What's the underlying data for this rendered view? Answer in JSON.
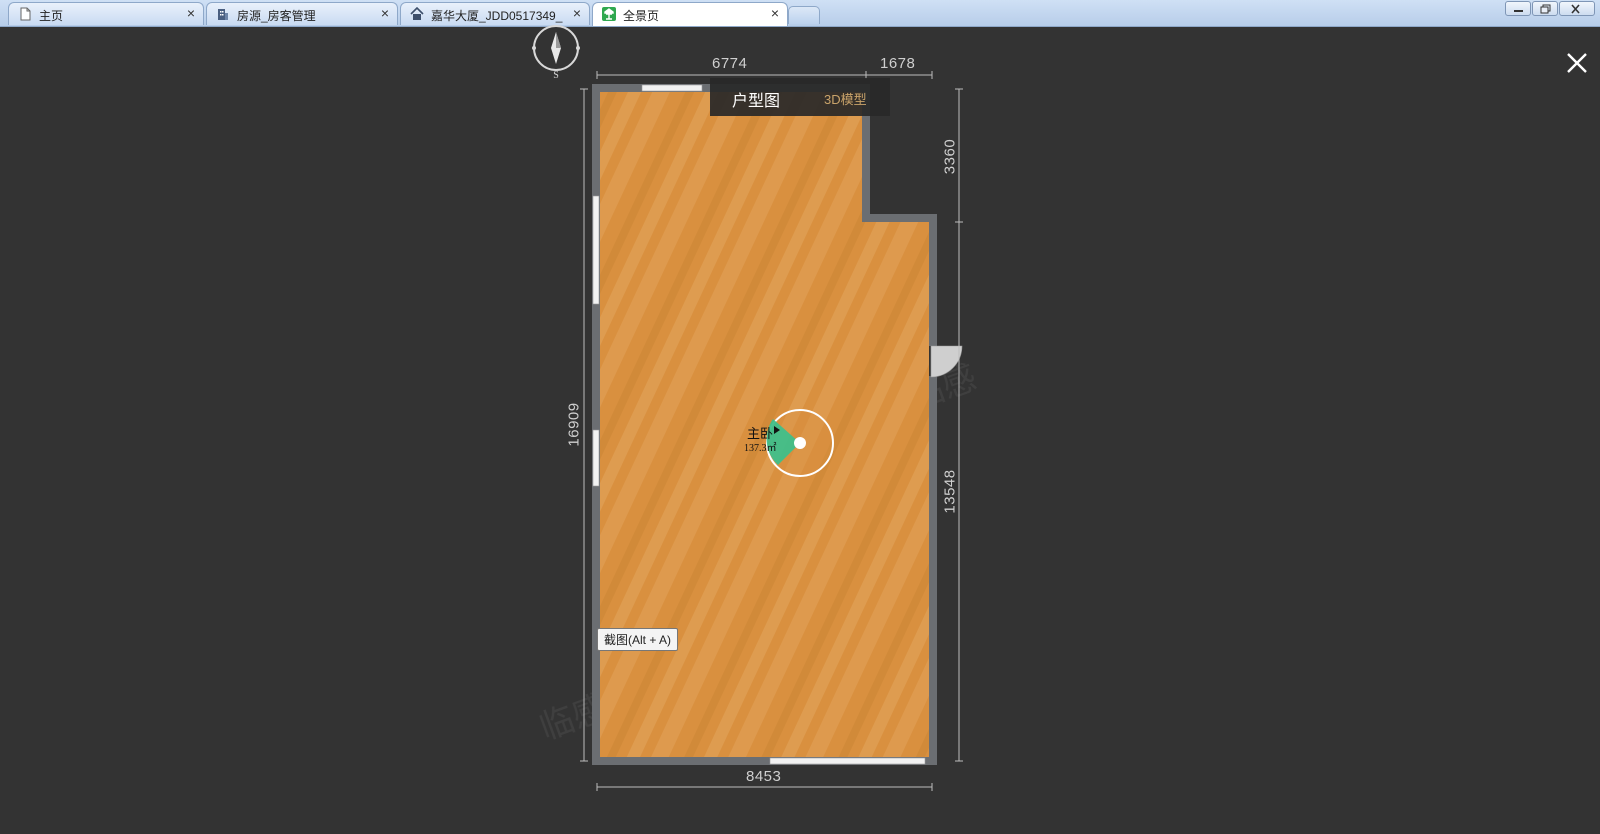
{
  "tabs": [
    {
      "label": "主页",
      "icon": "document-icon",
      "active": false
    },
    {
      "label": "房源_房客管理",
      "icon": "building-icon",
      "active": false
    },
    {
      "label": "嘉华大厦_JDD0517349_",
      "icon": "home-icon",
      "active": false
    },
    {
      "label": "全景页",
      "icon": "app-logo-icon",
      "active": true
    }
  ],
  "tab_close_glyph": "×",
  "window_controls": [
    "minimize-icon",
    "restore-icon",
    "close-icon"
  ],
  "viewer": {
    "close_icon": "close-x-icon",
    "compass_label": "S",
    "mode_switch": {
      "floorplan_label": "户型图",
      "model_label": "3D模型"
    },
    "dimensions": {
      "top_left": "6774",
      "top_right": "1678",
      "right_upper": "3360",
      "right_lower": "13548",
      "left": "16909",
      "bottom": "8453"
    },
    "room": {
      "name": "主卧",
      "area": "137.3㎡"
    },
    "screenshot_tip": "截图(Alt + A)",
    "watermark": "临感"
  },
  "colors": {
    "background": "#333333",
    "floor": "#d9903f",
    "wall": "#6b6e72",
    "view_cone": "#3fbf8a"
  }
}
